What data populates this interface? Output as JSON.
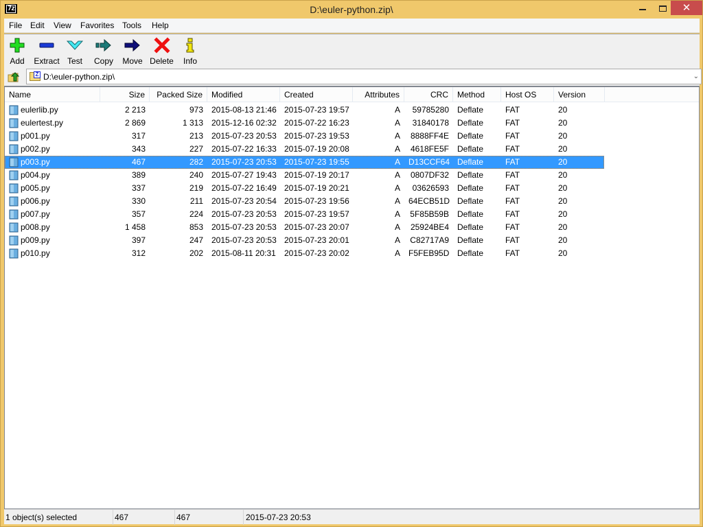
{
  "window": {
    "title": "D:\\euler-python.zip\\",
    "app_icon": "7z",
    "controls": {
      "minimize": "minimize",
      "maximize": "maximize",
      "close": "✕"
    }
  },
  "menu": [
    {
      "label": "File"
    },
    {
      "label": "Edit"
    },
    {
      "label": "View"
    },
    {
      "label": "Favorites"
    },
    {
      "label": "Tools"
    },
    {
      "label": "Help"
    }
  ],
  "toolbar": [
    {
      "label": "Add",
      "icon": "plus-icon",
      "color": "#22dd22"
    },
    {
      "label": "Extract",
      "icon": "minus-icon",
      "color": "#1a3ad6"
    },
    {
      "label": "Test",
      "icon": "check-chevron-icon",
      "color": "#44e8f2"
    },
    {
      "label": "Copy",
      "icon": "copy-arrow-icon",
      "color": "#1b7a78"
    },
    {
      "label": "Move",
      "icon": "move-arrow-icon",
      "color": "#10107a"
    },
    {
      "label": "Delete",
      "icon": "x-icon",
      "color": "#ee1111"
    },
    {
      "label": "Info",
      "icon": "info-icon",
      "color": "#f2e60e"
    }
  ],
  "address": {
    "path": "D:\\euler-python.zip\\"
  },
  "columns": [
    {
      "key": "name",
      "label": "Name"
    },
    {
      "key": "size",
      "label": "Size"
    },
    {
      "key": "packed",
      "label": "Packed Size"
    },
    {
      "key": "modified",
      "label": "Modified"
    },
    {
      "key": "created",
      "label": "Created"
    },
    {
      "key": "attributes",
      "label": "Attributes"
    },
    {
      "key": "crc",
      "label": "CRC"
    },
    {
      "key": "method",
      "label": "Method"
    },
    {
      "key": "hostos",
      "label": "Host OS"
    },
    {
      "key": "version",
      "label": "Version"
    }
  ],
  "files": [
    {
      "name": "eulerlib.py",
      "size": "2 213",
      "packed": "973",
      "modified": "2015-08-13 21:46",
      "created": "2015-07-23 19:57",
      "attributes": "A",
      "crc": "59785280",
      "method": "Deflate",
      "hostos": "FAT",
      "version": "20",
      "selected": false
    },
    {
      "name": "eulertest.py",
      "size": "2 869",
      "packed": "1 313",
      "modified": "2015-12-16 02:32",
      "created": "2015-07-22 16:23",
      "attributes": "A",
      "crc": "31840178",
      "method": "Deflate",
      "hostos": "FAT",
      "version": "20",
      "selected": false
    },
    {
      "name": "p001.py",
      "size": "317",
      "packed": "213",
      "modified": "2015-07-23 20:53",
      "created": "2015-07-23 19:53",
      "attributes": "A",
      "crc": "8888FF4E",
      "method": "Deflate",
      "hostos": "FAT",
      "version": "20",
      "selected": false
    },
    {
      "name": "p002.py",
      "size": "343",
      "packed": "227",
      "modified": "2015-07-22 16:33",
      "created": "2015-07-19 20:08",
      "attributes": "A",
      "crc": "4618FE5F",
      "method": "Deflate",
      "hostos": "FAT",
      "version": "20",
      "selected": false
    },
    {
      "name": "p003.py",
      "size": "467",
      "packed": "282",
      "modified": "2015-07-23 20:53",
      "created": "2015-07-23 19:55",
      "attributes": "A",
      "crc": "D13CCF64",
      "method": "Deflate",
      "hostos": "FAT",
      "version": "20",
      "selected": true
    },
    {
      "name": "p004.py",
      "size": "389",
      "packed": "240",
      "modified": "2015-07-27 19:43",
      "created": "2015-07-19 20:17",
      "attributes": "A",
      "crc": "0807DF32",
      "method": "Deflate",
      "hostos": "FAT",
      "version": "20",
      "selected": false
    },
    {
      "name": "p005.py",
      "size": "337",
      "packed": "219",
      "modified": "2015-07-22 16:49",
      "created": "2015-07-19 20:21",
      "attributes": "A",
      "crc": "03626593",
      "method": "Deflate",
      "hostos": "FAT",
      "version": "20",
      "selected": false
    },
    {
      "name": "p006.py",
      "size": "330",
      "packed": "211",
      "modified": "2015-07-23 20:54",
      "created": "2015-07-23 19:56",
      "attributes": "A",
      "crc": "64ECB51D",
      "method": "Deflate",
      "hostos": "FAT",
      "version": "20",
      "selected": false
    },
    {
      "name": "p007.py",
      "size": "357",
      "packed": "224",
      "modified": "2015-07-23 20:53",
      "created": "2015-07-23 19:57",
      "attributes": "A",
      "crc": "5F85B59B",
      "method": "Deflate",
      "hostos": "FAT",
      "version": "20",
      "selected": false
    },
    {
      "name": "p008.py",
      "size": "1 458",
      "packed": "853",
      "modified": "2015-07-23 20:53",
      "created": "2015-07-23 20:07",
      "attributes": "A",
      "crc": "25924BE4",
      "method": "Deflate",
      "hostos": "FAT",
      "version": "20",
      "selected": false
    },
    {
      "name": "p009.py",
      "size": "397",
      "packed": "247",
      "modified": "2015-07-23 20:53",
      "created": "2015-07-23 20:01",
      "attributes": "A",
      "crc": "C82717A9",
      "method": "Deflate",
      "hostos": "FAT",
      "version": "20",
      "selected": false
    },
    {
      "name": "p010.py",
      "size": "312",
      "packed": "202",
      "modified": "2015-08-11 20:31",
      "created": "2015-07-23 20:02",
      "attributes": "A",
      "crc": "F5FEB95D",
      "method": "Deflate",
      "hostos": "FAT",
      "version": "20",
      "selected": false
    }
  ],
  "status": {
    "selection": "1 object(s) selected",
    "size": "467",
    "packed": "467",
    "modified": "2015-07-23 20:53"
  },
  "colors": {
    "frame": "#f0c86b",
    "close_button": "#c84c4c",
    "selection": "#3399ff"
  }
}
